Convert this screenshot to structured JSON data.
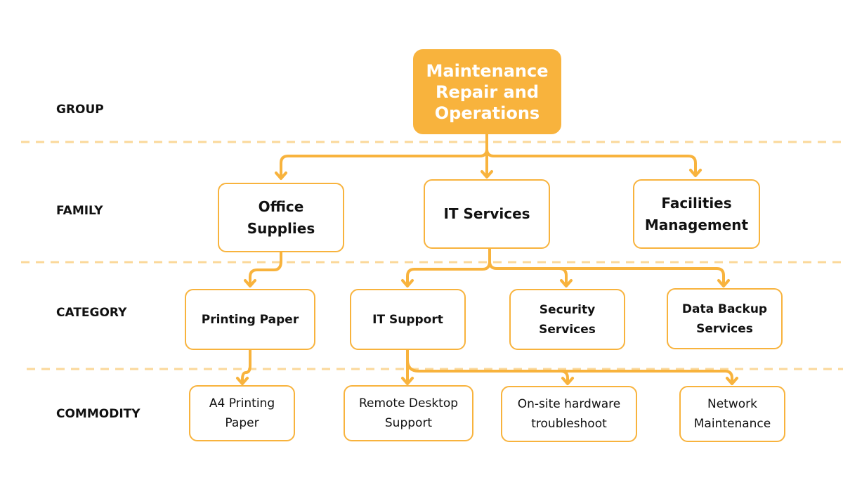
{
  "levels": [
    {
      "id": "group",
      "label": "GROUP"
    },
    {
      "id": "family",
      "label": "FAMILY"
    },
    {
      "id": "category",
      "label": "CATEGORY"
    },
    {
      "id": "commodity",
      "label": "COMMODITY"
    }
  ],
  "colors": {
    "accent": "#f8b33d",
    "divider": "#fbd89a",
    "text": "#111111",
    "root_text": "#ffffff"
  },
  "nodes": {
    "root": {
      "label": "Maintenance\nRepair and\nOperations"
    },
    "office_supplies": {
      "label": "Office\nSupplies"
    },
    "it_services": {
      "label": "IT Services"
    },
    "facilities_management": {
      "label": "Facilities\nManagement"
    },
    "printing_paper": {
      "label": "Printing Paper"
    },
    "it_support": {
      "label": "IT Support"
    },
    "security_services": {
      "label": "Security\nServices"
    },
    "data_backup_services": {
      "label": "Data Backup\nServices"
    },
    "a4_printing_paper": {
      "label": "A4 Printing\nPaper"
    },
    "remote_desktop_support": {
      "label": "Remote Desktop\nSupport"
    },
    "onsite_hardware_troubleshoot": {
      "label": "On-site hardware\ntroubleshoot"
    },
    "network_maintenance": {
      "label": "Network\nMaintenance"
    }
  },
  "edges": [
    [
      "root",
      "office_supplies"
    ],
    [
      "root",
      "it_services"
    ],
    [
      "root",
      "facilities_management"
    ],
    [
      "office_supplies",
      "printing_paper"
    ],
    [
      "it_services",
      "it_support"
    ],
    [
      "it_services",
      "security_services"
    ],
    [
      "it_services",
      "data_backup_services"
    ],
    [
      "printing_paper",
      "a4_printing_paper"
    ],
    [
      "it_support",
      "remote_desktop_support"
    ],
    [
      "it_support",
      "onsite_hardware_troubleshoot"
    ],
    [
      "it_support",
      "network_maintenance"
    ]
  ]
}
